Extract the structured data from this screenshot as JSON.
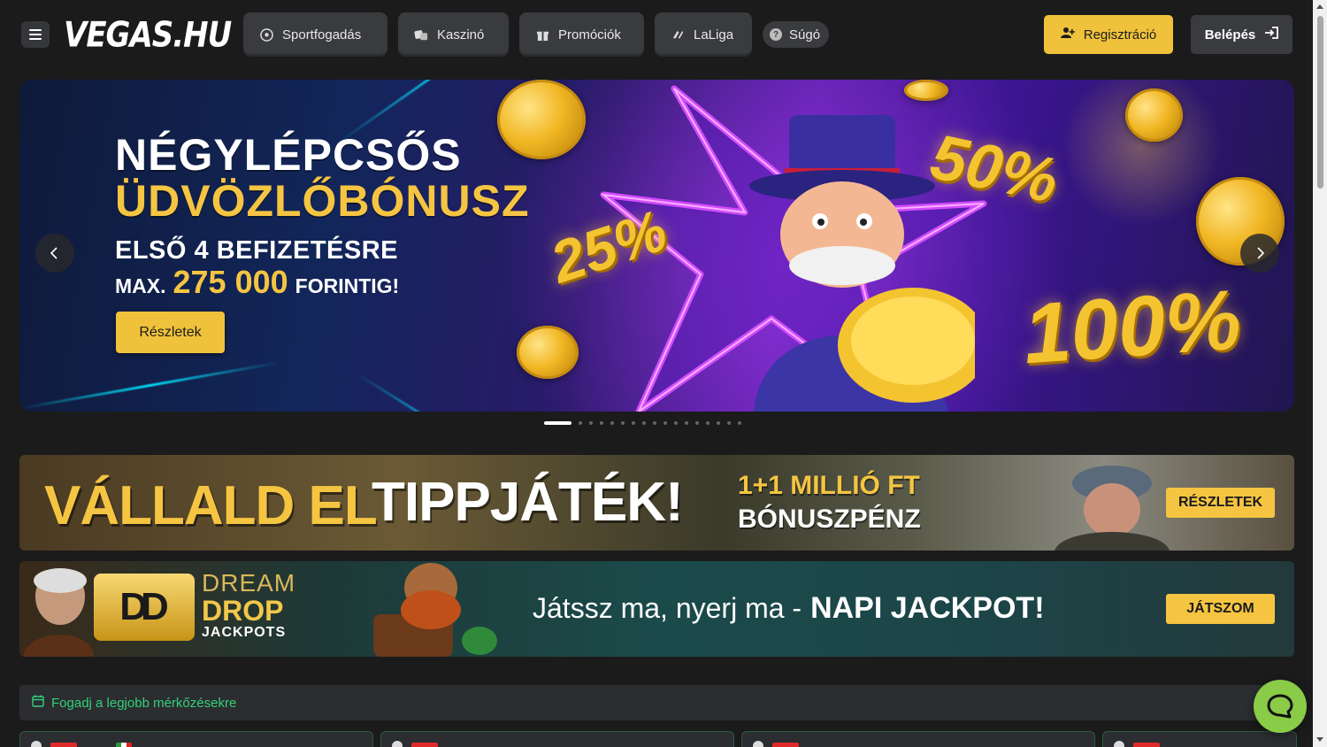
{
  "header": {
    "logo": "VEGAS.HU",
    "nav": [
      {
        "label": "Sportfogadás",
        "icon": "soccer-ball-icon"
      },
      {
        "label": "Kaszinó",
        "icon": "dice-icon"
      },
      {
        "label": "Promóciók",
        "icon": "gift-icon"
      },
      {
        "label": "LaLiga",
        "icon": "laliga-icon"
      }
    ],
    "help_label": "Súgó",
    "register_label": "Regisztráció",
    "login_label": "Belépés"
  },
  "hero": {
    "title_line1": "NÉGYLÉPCSŐS",
    "title_line2": "ÜDVÖZLŐBÓNUSZ",
    "sub_line1": "ELSŐ 4 BEFIZETÉSRE",
    "sub_prefix": "MAX.",
    "sub_amount": "275 000",
    "sub_suffix": "FORINTIG!",
    "cta_label": "Részletek",
    "pct_small": "25%",
    "pct_mid": "50%",
    "pct_big": "100%",
    "slide_count": 17,
    "active_slide": 1
  },
  "banner_tipp": {
    "title_yellow": "VÁLLALD EL",
    "title_white": "TIPPJÁTÉK!",
    "bonus_line1": "1+1 MILLIÓ FT",
    "bonus_line2": "BÓNUSZPÉNZ",
    "button_label": "RÉSZLETEK"
  },
  "banner_dreamdrop": {
    "logo_mark": "DD",
    "logo_line1": "DREAM",
    "logo_line2": "DROP",
    "logo_line3": "JACKPOTS",
    "tagline_light": "Játssz ma, nyerj ma -",
    "tagline_bold": "NAPI JACKPOT!",
    "button_label": "JÁTSZOM"
  },
  "bets": {
    "heading": "Fogadj a legjobb mérkőzésekre"
  },
  "colors": {
    "accent_yellow": "#f0c23b",
    "bet_green": "#33d17a",
    "chat_green": "#8acb47",
    "background": "#1b1b1c"
  }
}
